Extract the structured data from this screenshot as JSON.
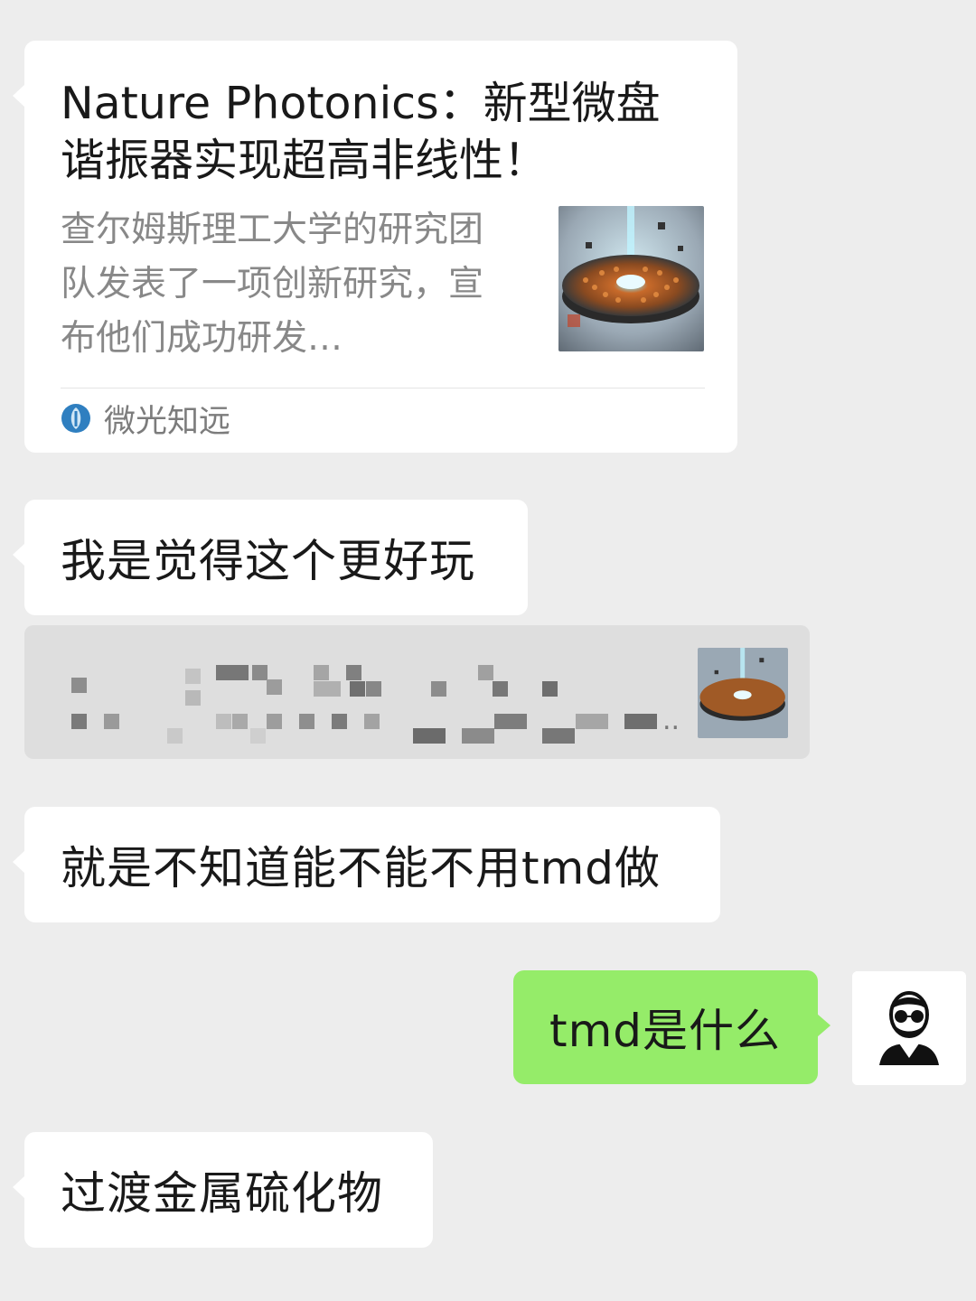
{
  "chat": {
    "article_card": {
      "title": "Nature Photonics：新型微盘谐振器实现超高非线性！",
      "description": "查尔姆斯理工大学的研究团队发表了一项创新研究，宣布他们成功研发…",
      "source": "微光知远",
      "thumbnail_icon": "microdisk-resonator-image"
    },
    "messages": [
      {
        "side": "left",
        "text": "我是觉得这个更好玩"
      },
      {
        "side": "left",
        "text": "就是不知道能不能不用tmd做"
      },
      {
        "side": "right",
        "text": "tmd是什么"
      },
      {
        "side": "left",
        "text": "过渡金属硫化物"
      }
    ],
    "quote": {
      "ellipsis": "..",
      "thumbnail_icon": "microdisk-resonator-image"
    },
    "avatar_icon": "bearded-man-sunglasses-avatar"
  },
  "colors": {
    "background": "#ededed",
    "incoming_bubble": "#ffffff",
    "outgoing_bubble": "#95ec69",
    "secondary_text": "#888888"
  }
}
